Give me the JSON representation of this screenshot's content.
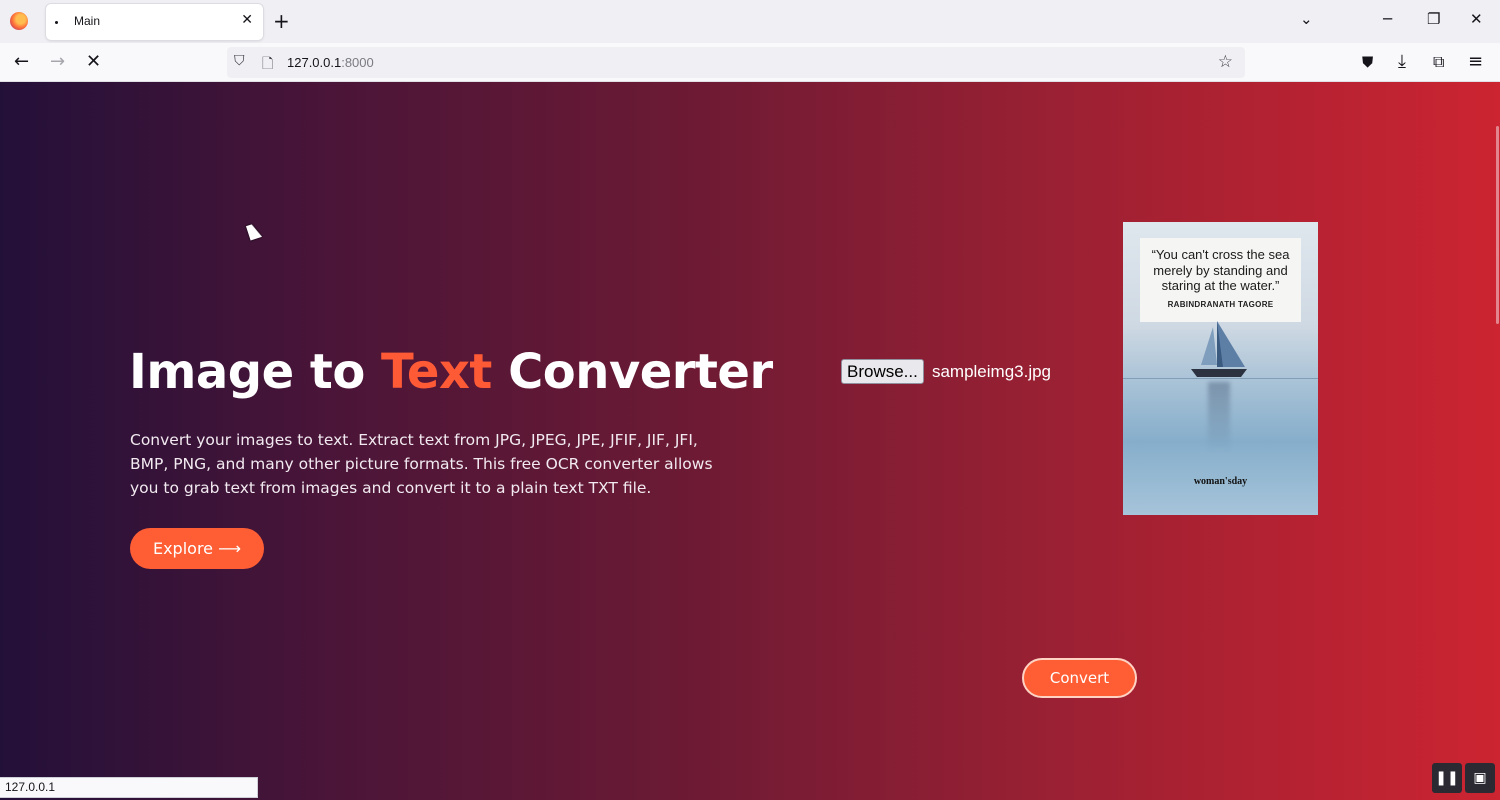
{
  "browser": {
    "tab_title": "Main",
    "tab_close": "✕",
    "new_tab": "+",
    "url_host": "127.0.0.1",
    "url_port": ":8000",
    "status_url": "127.0.0.1"
  },
  "hero": {
    "title_part1": "Image to ",
    "title_accent": "Text",
    "title_part2": " Converter",
    "description": "Convert your images to text. Extract text from JPG, JPEG, JPE, JFIF, JIF, JFI, BMP, PNG, and many other picture formats. This free OCR converter allows you to grab text from images and convert it to a plain text TXT file.",
    "explore_label": "Explore ⟶"
  },
  "upload": {
    "browse_label": "Browse...",
    "file_name": "sampleimg3.jpg",
    "convert_label": "Convert"
  },
  "preview": {
    "quote": "“You can't cross the sea merely by standing and staring at the water.”",
    "author": "RABINDRANATH TAGORE",
    "brand": "woman'sday"
  },
  "colors": {
    "accent": "#ff5e34",
    "gradient_start": "#231039",
    "gradient_end": "#cc2431"
  }
}
